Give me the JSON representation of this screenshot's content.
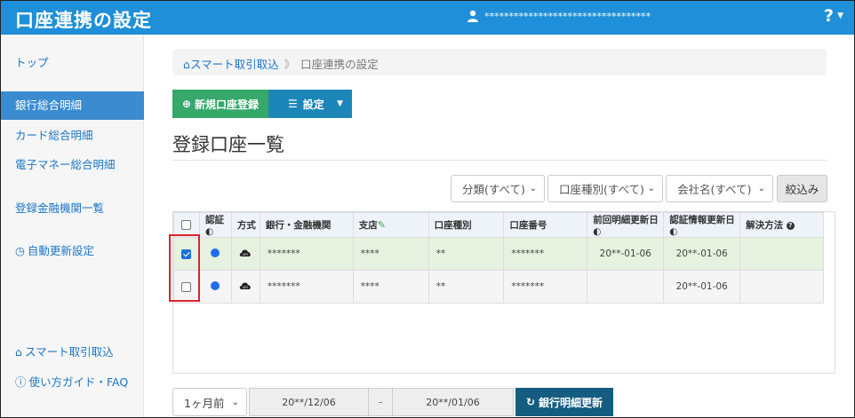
{
  "header": {
    "title": "口座連携の設定",
    "user_name": "**********************************",
    "help_label": "?"
  },
  "sidebar": {
    "items": [
      {
        "label": "トップ",
        "active": false
      },
      {
        "label": "銀行総合明細",
        "active": true
      },
      {
        "label": "カード総合明細",
        "active": false
      },
      {
        "label": "電子マネー総合明細",
        "active": false
      },
      {
        "label": "登録金融機関一覧",
        "active": false
      },
      {
        "label": "自動更新設定",
        "active": false
      }
    ],
    "footer_links": [
      {
        "label": "スマート取引取込"
      },
      {
        "label": "使い方ガイド・FAQ"
      }
    ]
  },
  "breadcrumb": {
    "link": "スマート取引取込",
    "separator": "》",
    "current": "口座連携の設定"
  },
  "toolbar": {
    "new_label": "新規口座登録",
    "setting_label": "設定"
  },
  "page_title": "登録口座一覧",
  "filters": {
    "category": "分類(すべて)",
    "account_type": "口座種別(すべて)",
    "company": "会社名(すべて)",
    "apply_label": "絞込み"
  },
  "table": {
    "headers": [
      "認証",
      "方式",
      "銀行・金融機関",
      "支店",
      "口座種別",
      "口座番号",
      "前回明細更新日",
      "認証情報更新日",
      "解決方法"
    ],
    "method_icon_text": "API",
    "rows": [
      {
        "checked": true,
        "bank": "*******",
        "branch": "****",
        "type": "**",
        "number": "*******",
        "last_update": "20**-01-06",
        "auth_update": "20**-01-06",
        "resolution": ""
      },
      {
        "checked": false,
        "bank": "*******",
        "branch": "****",
        "type": "**",
        "number": "*******",
        "last_update": "",
        "auth_update": "20**-01-06",
        "resolution": ""
      }
    ]
  },
  "bottom": {
    "period": "1ヶ月前",
    "from_date": "20**/12/06",
    "separator": "-",
    "to_date": "20**/01/06",
    "update_label": "銀行明細更新"
  },
  "colors": {
    "header_bg": "#1e8fd8",
    "active_sidebar": "#3b8bd0",
    "new_button": "#35a86a",
    "setting_button": "#1d86b8",
    "update_button": "#155d80",
    "highlight_border": "#d9262c",
    "status_dot": "#1f6cf0"
  }
}
